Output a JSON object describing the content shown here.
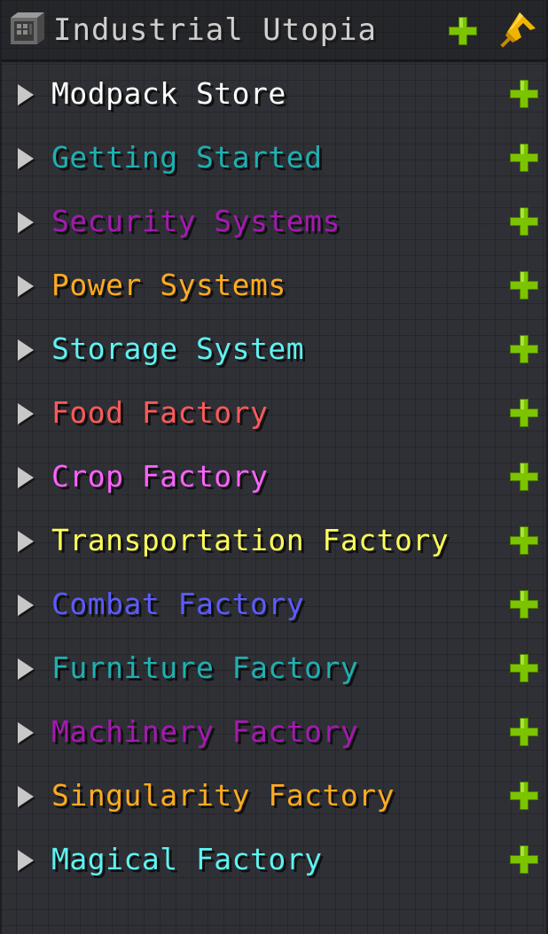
{
  "header": {
    "title": "Industrial Utopia",
    "icons": {
      "app": "machine-block-icon",
      "add": "plus-icon",
      "pin": "pin-icon"
    }
  },
  "colors": {
    "plus": "#7cc400",
    "plus_dark": "#4c7a00",
    "pin": "#f0b400",
    "chevron": "#c8c8c8"
  },
  "chapters": [
    {
      "label": "Modpack Store",
      "color": "#ffffff"
    },
    {
      "label": "Getting Started",
      "color": "#1fb0b2"
    },
    {
      "label": "Security Systems",
      "color": "#a41ab0"
    },
    {
      "label": "Power Systems",
      "color": "#ffab20"
    },
    {
      "label": "Storage System",
      "color": "#5ff2f2"
    },
    {
      "label": "Food Factory",
      "color": "#ff5a5a"
    },
    {
      "label": "Crop Factory",
      "color": "#ff62ff"
    },
    {
      "label": "Transportation Factory",
      "color": "#ffff5a"
    },
    {
      "label": "Combat Factory",
      "color": "#5c5cff"
    },
    {
      "label": "Furniture Factory",
      "color": "#1fb0b2"
    },
    {
      "label": "Machinery Factory",
      "color": "#a41ab0"
    },
    {
      "label": "Singularity Factory",
      "color": "#ffab20"
    },
    {
      "label": "Magical Factory",
      "color": "#5ff2f2"
    }
  ]
}
